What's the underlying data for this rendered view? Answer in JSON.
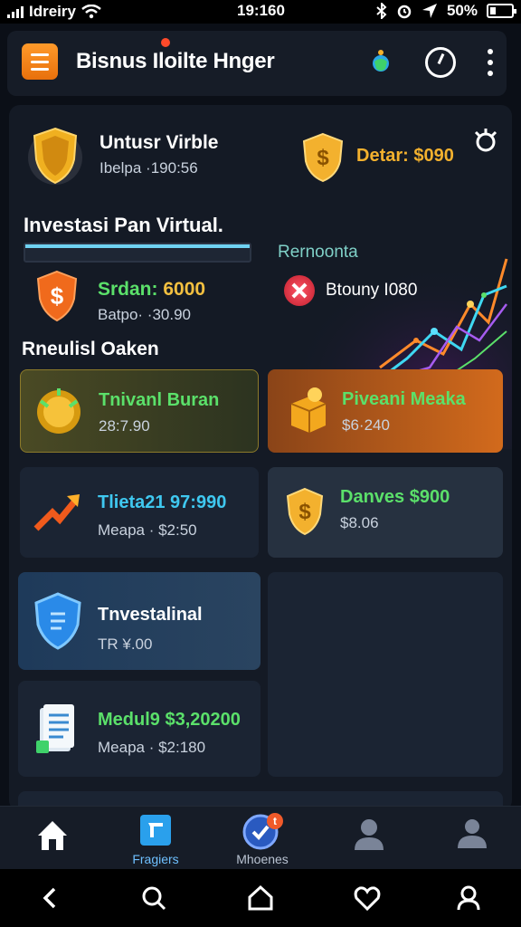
{
  "status_bar": {
    "carrier": "Idreiry",
    "time": "19:160",
    "battery": "50%"
  },
  "header": {
    "title": "Bisnus Iloilte Hnger"
  },
  "profile": {
    "name": "Untusr Virble",
    "sub": "Ibelpa ·190:56",
    "balance": "Detar: $090"
  },
  "section_invest": {
    "title": "Investasi Pan Virtual.",
    "recommend_label": "Rernoonta"
  },
  "saldo": {
    "label": "Srdan:",
    "value": "6000",
    "sub": "Batpo· ·30.90"
  },
  "brown": {
    "label": "Btouny I080"
  },
  "section_recs": {
    "title": "Rneulisl Oaken"
  },
  "cards": [
    {
      "title": "Tnivanl Buran",
      "sub": "28:7.90",
      "icon": "gold-coin-icon"
    },
    {
      "title": "Piveani Meaka",
      "sub": "$6·240",
      "icon": "gold-cube-icon"
    },
    {
      "title": "Tlieta21 97:990",
      "sub": "Meapa · $2:50",
      "icon": "trend-arrow-icon"
    },
    {
      "title": "Danves $900",
      "sub": "$8.06",
      "icon": "dollar-shield-icon"
    },
    {
      "title": "Tnvestalinal",
      "sub": "TR ¥.00",
      "icon": "blue-shield-icon"
    },
    {
      "title": "Medul9 $3,20200",
      "sub": "Meapa · $2:180",
      "icon": "document-stack-icon"
    }
  ],
  "nav": [
    {
      "label": "",
      "icon": "home-icon"
    },
    {
      "label": "Fragiers",
      "icon": "portfolio-icon"
    },
    {
      "label": "Mhoenes",
      "icon": "badge-icon",
      "badge": "t"
    },
    {
      "label": "",
      "icon": "profile-icon"
    },
    {
      "label": "",
      "icon": "account-icon"
    }
  ],
  "colors": {
    "accent_orange": "#f08a1c",
    "gold": "#f3b12e",
    "green": "#5be06a",
    "bg": "#0b0f17",
    "card": "#1b2433"
  }
}
